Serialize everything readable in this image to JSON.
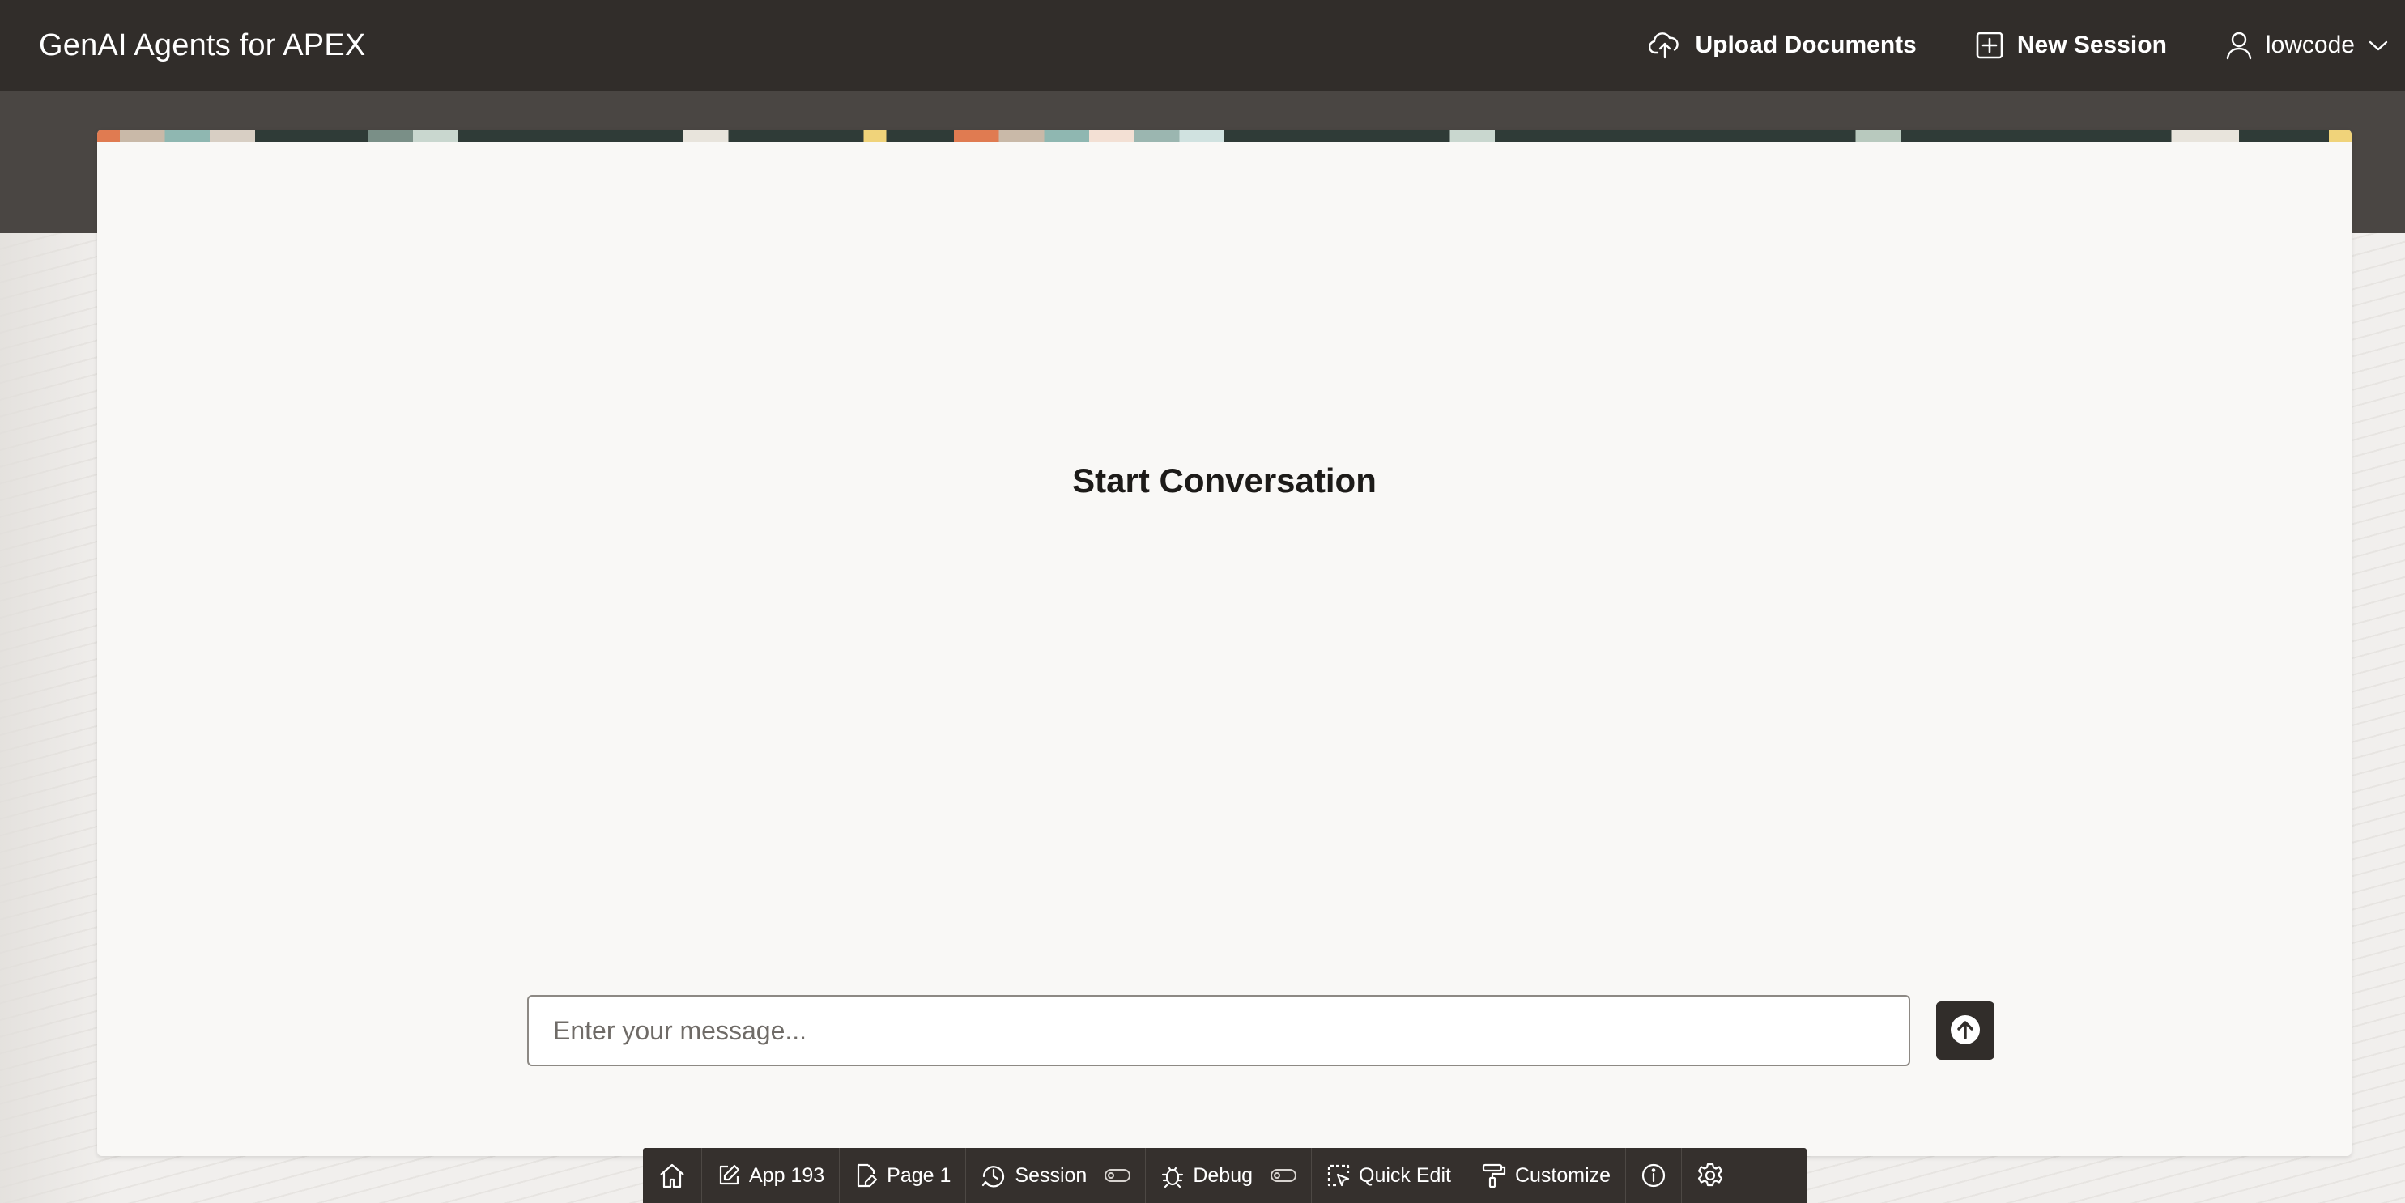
{
  "header": {
    "app_title": "GenAI Agents for APEX",
    "upload_label": "Upload Documents",
    "new_session_label": "New Session",
    "user_name": "lowcode"
  },
  "main": {
    "heading": "Start Conversation",
    "message_placeholder": "Enter your message..."
  },
  "dev_toolbar": {
    "app_label": "App 193",
    "page_label": "Page 1",
    "session_label": "Session",
    "debug_label": "Debug",
    "quick_edit_label": "Quick Edit",
    "customize_label": "Customize"
  },
  "icons": {
    "upload": "cloud-upload-icon",
    "new_session": "plus-square-icon",
    "user": "user-icon",
    "send": "arrow-up-circle-icon",
    "home": "home-icon",
    "app": "pencil-square-icon",
    "page": "page-edit-icon",
    "session": "clock-icon",
    "debug": "bug-icon",
    "quick_edit": "cursor-select-icon",
    "customize": "paint-roller-icon",
    "info": "info-icon",
    "settings": "gear-icon"
  },
  "colors": {
    "header_bg": "#312d2a",
    "hero_bg": "#4a4643",
    "card_bg": "#f9f8f6",
    "devbar_bg": "#35302d",
    "send_bg": "#312d2a"
  }
}
